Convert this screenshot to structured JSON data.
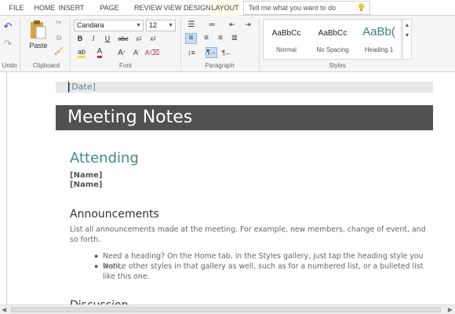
{
  "tabs": [
    {
      "label": "FILE"
    },
    {
      "label": "HOME"
    },
    {
      "label": "INSERT"
    },
    {
      "label": "PAGE LAYOUT"
    },
    {
      "label": "REVIEW"
    },
    {
      "label": "VIEW"
    },
    {
      "label": "DESIGN"
    },
    {
      "label": "LAYOUT"
    }
  ],
  "active_tab": "LAYOUT",
  "tell_me": {
    "placeholder": "Tell me what you want to do"
  },
  "ribbon": {
    "undo_label": "Undo",
    "clipboard": {
      "label": "Clipboard",
      "paste_label": "Paste"
    },
    "font": {
      "label": "Font",
      "family": "Candara",
      "size": "12"
    },
    "paragraph": {
      "label": "Paragraph"
    },
    "styles": {
      "label": "Styles",
      "items": [
        {
          "sample": "AaBbCc",
          "name": "Normal"
        },
        {
          "sample": "AaBbCc",
          "name": "No Spacing"
        },
        {
          "sample": "AaBb(",
          "name": "Heading 1"
        }
      ]
    }
  },
  "document": {
    "date": "[Date]",
    "title": "Meeting Notes",
    "attending_heading": "Attending",
    "names": [
      "[Name]",
      "[Name]"
    ],
    "announcements_heading": "Announcements",
    "announcements_para": "List all announcements made at the meeting. For example, new members, change of event, and so forth.",
    "bullets": [
      "Need a heading? On the Home tab, in the Styles gallery, just tap the heading style you want.",
      "Notice other styles in that gallery as well, such as for a numbered list, or a bulleted list like this one."
    ],
    "next_heading": "Discussion"
  },
  "colors": {
    "accent_teal": "#3f8a86",
    "title_bar": "#515151",
    "active_tab_bg": "#fdfbe9"
  }
}
